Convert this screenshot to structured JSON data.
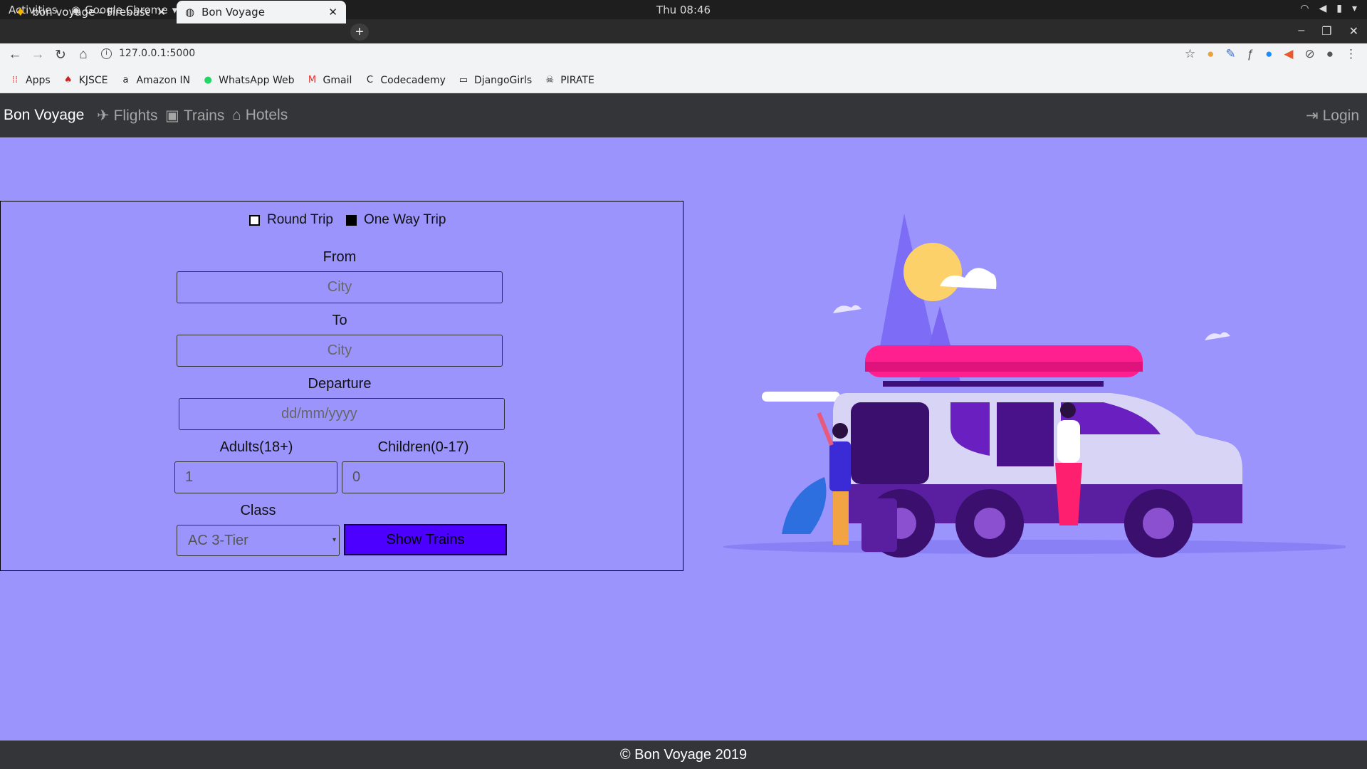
{
  "os": {
    "activities": "Activities",
    "app_name": "Google Chrome",
    "clock": "Thu 08:46"
  },
  "browser": {
    "tabs": [
      {
        "title": "bon voyage – Firebase co"
      },
      {
        "title": "Bon Voyage"
      }
    ],
    "url": "127.0.0.1:5000",
    "bookmarks": [
      "Apps",
      "KJSCE",
      "Amazon IN",
      "WhatsApp Web",
      "Gmail",
      "Codecademy",
      "DjangoGirls",
      "PIRATE"
    ]
  },
  "site": {
    "brand": "Bon Voyage",
    "nav": {
      "flights": "Flights",
      "trains": "Trains",
      "hotels": "Hotels",
      "login": "Login"
    },
    "footer": "© Bon Voyage 2019"
  },
  "form": {
    "trip_options": [
      {
        "label": "Round Trip",
        "checked": false
      },
      {
        "label": "One Way Trip",
        "checked": true
      }
    ],
    "from_label": "From",
    "from_placeholder": "City",
    "to_label": "To",
    "to_placeholder": "City",
    "departure_label": "Departure",
    "departure_placeholder": "dd/mm/yyyy",
    "adults_label": "Adults(18+)",
    "adults_value": "1",
    "children_label": "Children(0-17)",
    "children_value": "0",
    "class_label": "Class",
    "class_value": "AC 3-Tier",
    "submit_label": "Show Trains"
  },
  "colors": {
    "page_bg": "#9b94fc",
    "navbar_bg": "#333538",
    "button_bg": "#4c00ff"
  }
}
